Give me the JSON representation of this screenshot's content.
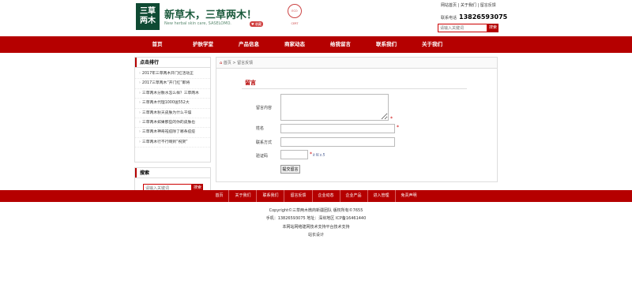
{
  "header": {
    "logo_line1": "三草",
    "logo_line2": "两木",
    "slogan": "新草木，三草两木！",
    "sub_slogan": "New herbal skin care, SASELOMO.",
    "fav_badge": "♥ 收藏",
    "seal_text": "ECO CERT",
    "top_links": "网站首页 | 关于我们 | 留言反馈",
    "phone_label": "联系电话",
    "phone_number": "13826593075",
    "search_placeholder": "请输入关键词",
    "search_button": "搜索"
  },
  "nav": {
    "items": [
      "首页",
      "护肤学堂",
      "产品信息",
      "商家动态",
      "给我留言",
      "联系我们",
      "关于我们"
    ]
  },
  "sidebar": {
    "ranking_title": "点击排行",
    "ranking_items": [
      "2017年三草两木开门红活动正",
      "2017三草两木“开门红”即将",
      "三草两木分散水怎么样？三草两木",
      "三草两木代理1000送552大",
      "三草两木秋天皮肤为什么干燥",
      "三草两木如果那些的你的皮肤也",
      "三草两木神奇祛痘除了哪条痘痘",
      "三草两木行不行啊到“祝贺”"
    ],
    "search_title": "搜索",
    "search_placeholder": "请输入关键词",
    "search_button": "搜索"
  },
  "main": {
    "breadcrumb_home": "首页",
    "breadcrumb_sep": " > ",
    "breadcrumb_current": "留言反馈",
    "section_title": "留言",
    "label_content": "留言内容",
    "label_name": "姓名",
    "label_contact": "联系方式",
    "label_captcha": "验证码",
    "required_mark": "*",
    "captcha_text": "kNs5",
    "submit_label": "提交留言"
  },
  "footer": {
    "links": [
      "首页",
      "关于我们",
      "联系我们",
      "留言反馈",
      "企业动态",
      "企业产品",
      "进入管理",
      "免责声明"
    ],
    "copyright": "Copyright©三草两木微商新疆团队 版权所有©7655",
    "contact": "手机：13826593075 地址：深圳地区 ICP备16461440",
    "support": "本网站网络建网技术支持平台技术支持",
    "design": "站长设计"
  }
}
